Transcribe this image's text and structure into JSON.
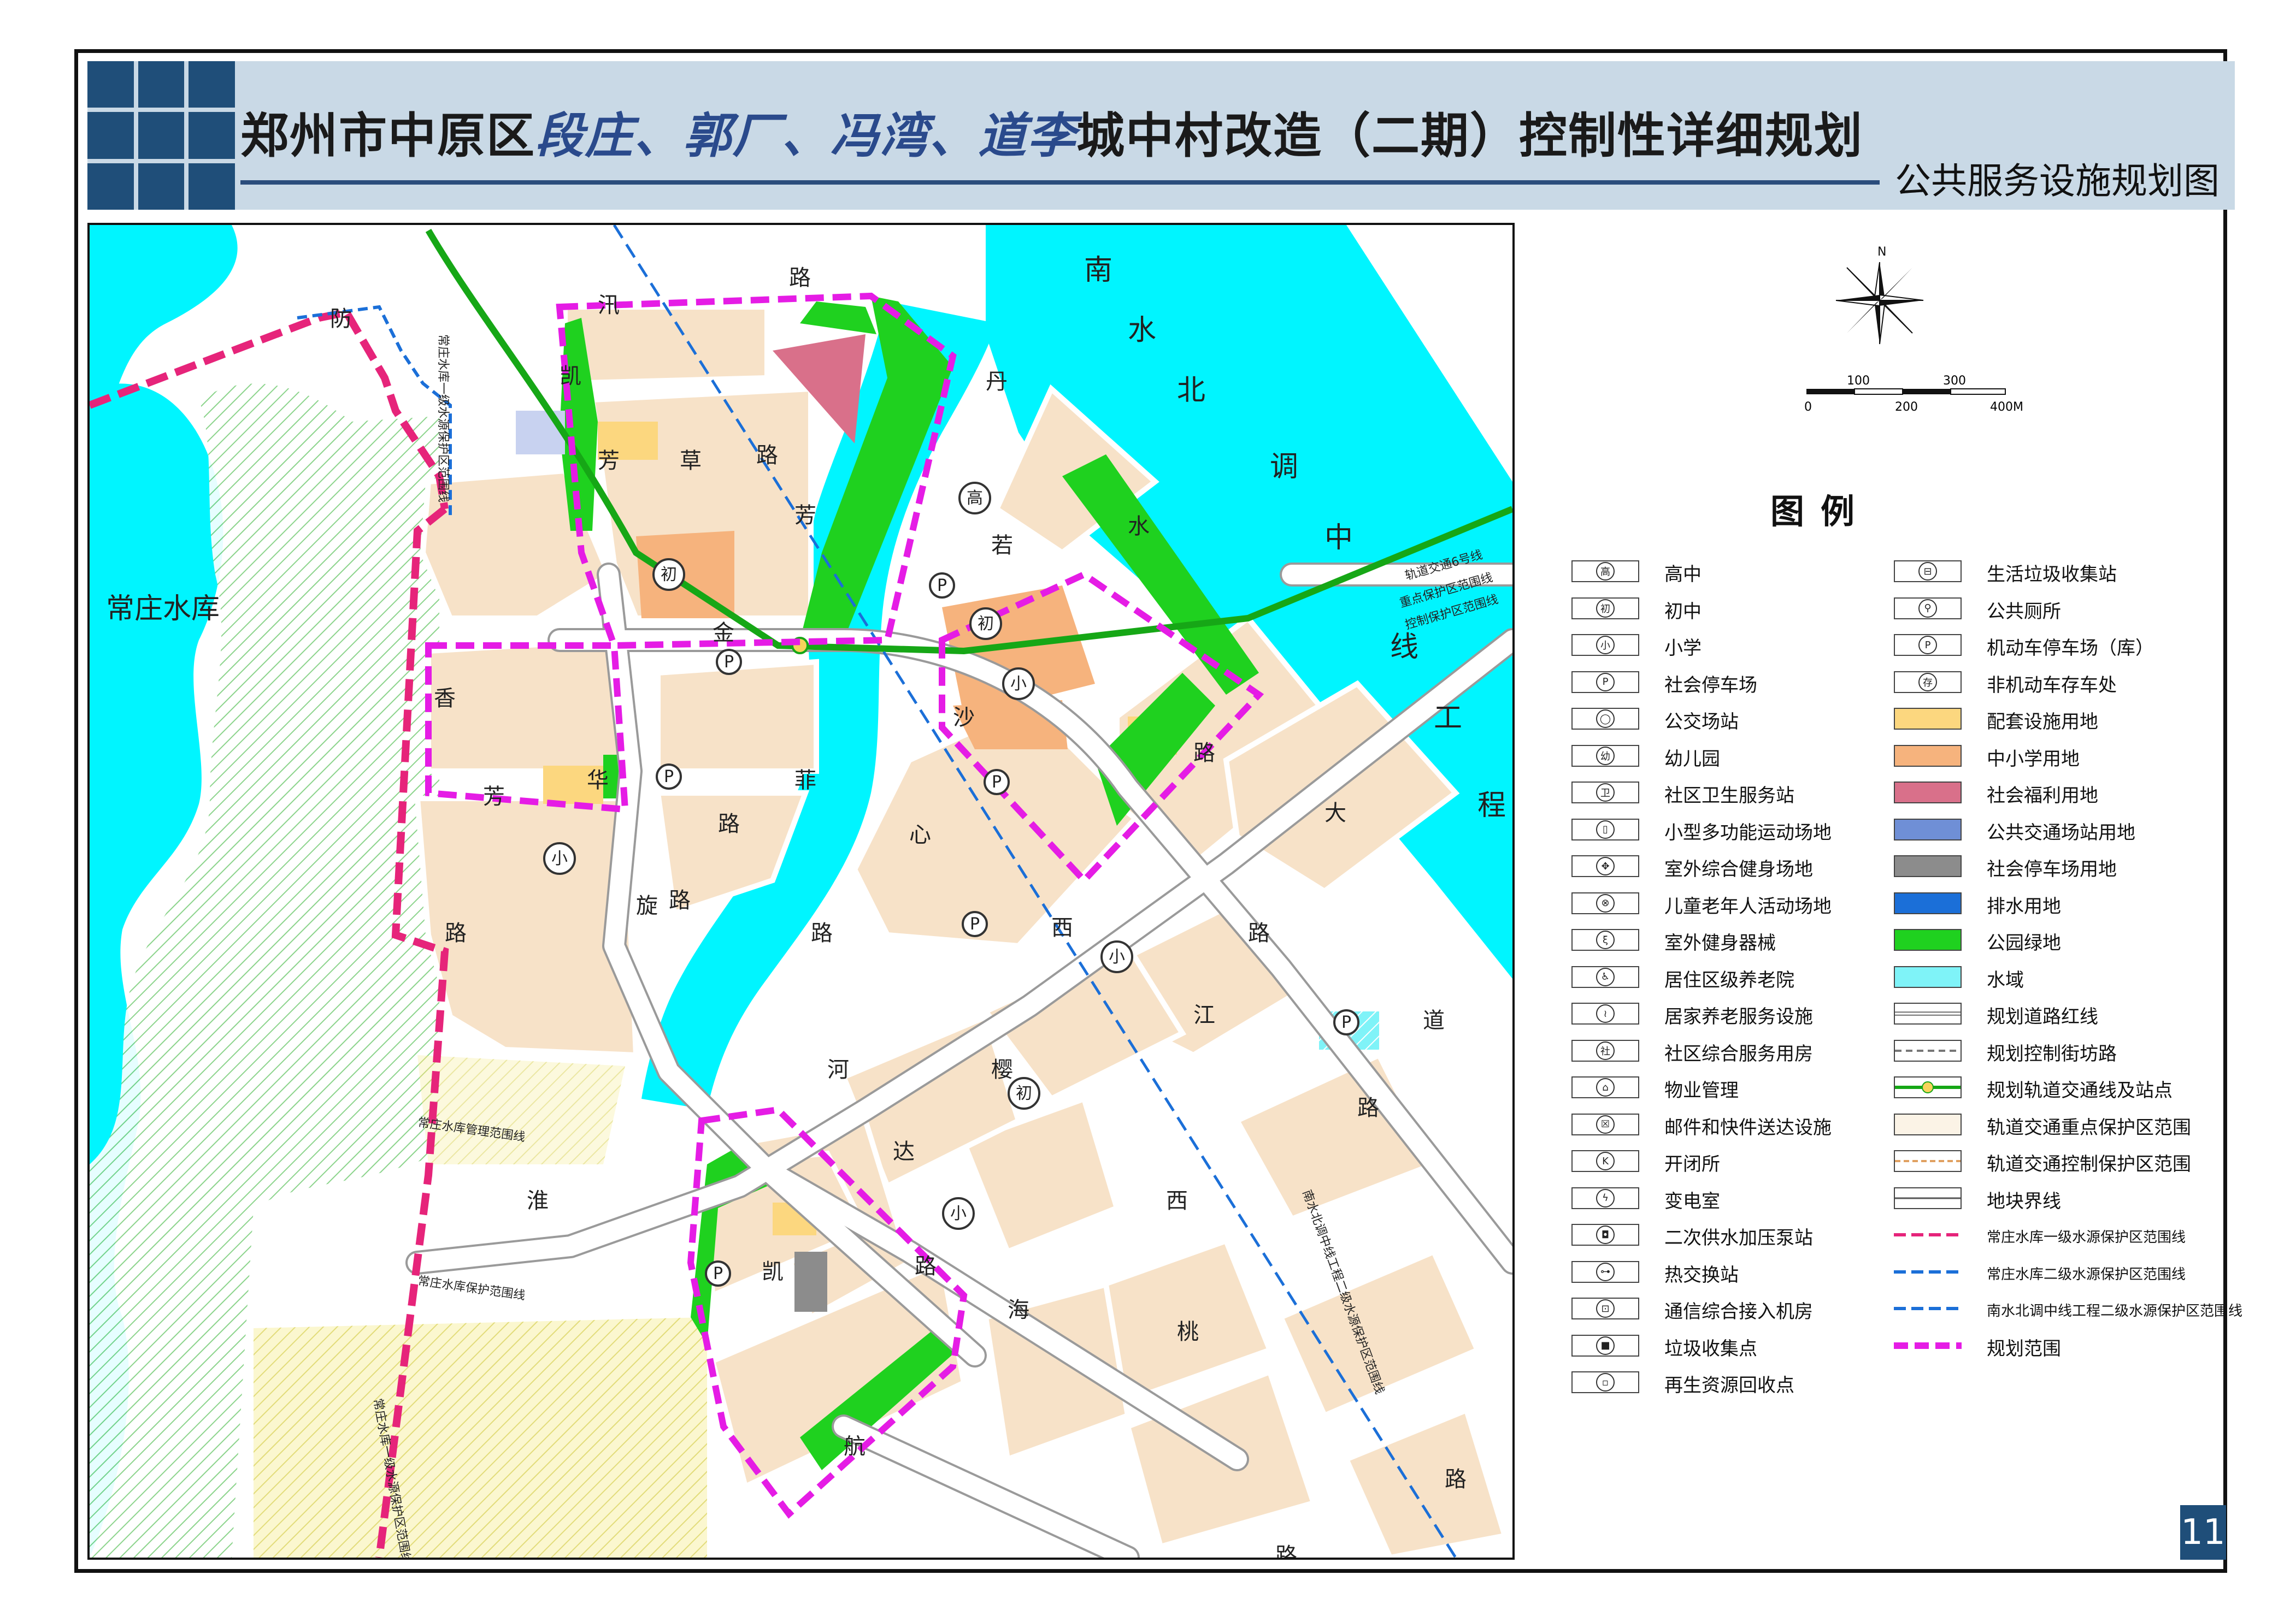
{
  "title": {
    "prefix": "郑州市中原区",
    "villages": "段庄、郭厂、冯湾、道李",
    "suffix": "城中村改造（二期）控制性详细规划"
  },
  "subtitle": "公共服务设施规划图",
  "page_number": "11",
  "scale_bar": {
    "ticks": [
      "0",
      "100",
      "200",
      "300",
      "400M"
    ]
  },
  "north": "N",
  "colors": {
    "water": "#00f5ff",
    "park_green": "#1fd11f",
    "residential": "#f7e2c8",
    "school": "#f6b37d",
    "welfare": "#d9708a",
    "supporting": "#fcd77f",
    "planning_boundary": "#e51ce5",
    "reservoir_boundary": "#e6247a",
    "water_protect_line": "#1b6fd8",
    "rail_line": "#16a716"
  },
  "map": {
    "place_labels": {
      "reservoir": "常庄水库",
      "south_north_canal": [
        "南",
        "水",
        "北",
        "调",
        "中",
        "线",
        "工",
        "程"
      ]
    },
    "road_labels": [
      {
        "text": "防",
        "kind": "road"
      },
      {
        "text": "汛",
        "kind": "road"
      },
      {
        "text": "路",
        "kind": "road"
      },
      {
        "text": "凯",
        "kind": "road"
      },
      {
        "text": "芳",
        "kind": "road"
      },
      {
        "text": "草",
        "kind": "road"
      },
      {
        "text": "路",
        "kind": "road"
      },
      {
        "text": "芳",
        "kind": "road"
      },
      {
        "text": "丹",
        "kind": "road"
      },
      {
        "text": "水",
        "kind": "road"
      },
      {
        "text": "若",
        "kind": "road"
      },
      {
        "text": "金",
        "kind": "road"
      },
      {
        "text": "沙",
        "kind": "road"
      },
      {
        "text": "香",
        "kind": "road"
      },
      {
        "text": "芳",
        "kind": "road"
      },
      {
        "text": "华",
        "kind": "road"
      },
      {
        "text": "菲",
        "kind": "road"
      },
      {
        "text": "路",
        "kind": "road"
      },
      {
        "text": "旋",
        "kind": "road"
      },
      {
        "text": "路",
        "kind": "road"
      },
      {
        "text": "路",
        "kind": "road"
      },
      {
        "text": "心",
        "kind": "road"
      },
      {
        "text": "路",
        "kind": "road"
      },
      {
        "text": "路",
        "kind": "road"
      },
      {
        "text": "大",
        "kind": "road"
      },
      {
        "text": "西",
        "kind": "road"
      },
      {
        "text": "路",
        "kind": "road"
      },
      {
        "text": "江",
        "kind": "road"
      },
      {
        "text": "道",
        "kind": "road"
      },
      {
        "text": "河",
        "kind": "road"
      },
      {
        "text": "樱",
        "kind": "road"
      },
      {
        "text": "路",
        "kind": "road"
      },
      {
        "text": "达",
        "kind": "road"
      },
      {
        "text": "淮",
        "kind": "road"
      },
      {
        "text": "西",
        "kind": "road"
      },
      {
        "text": "凯",
        "kind": "road"
      },
      {
        "text": "路",
        "kind": "road"
      },
      {
        "text": "海",
        "kind": "road"
      },
      {
        "text": "桃",
        "kind": "road"
      },
      {
        "text": "航",
        "kind": "road"
      },
      {
        "text": "路",
        "kind": "road"
      },
      {
        "text": "路",
        "kind": "road"
      }
    ],
    "line_labels": {
      "rail6": "轨道交通6号线",
      "rail_key": "重点保护区范围线",
      "rail_ctrl": "控制保护区范围线",
      "res1": "常庄水库一级水源保护区范围线",
      "res_mgmt": "常庄水库管理范围线",
      "res_protect": "常庄水库保护范围线",
      "res1_south": "常庄水库一级水源保护区范围线",
      "canal2": "南水北调中线工程二级水源保护区范围线"
    },
    "facility_badges": {
      "high": "高",
      "middle": "初",
      "primary": "小",
      "parking": "P"
    }
  },
  "legend": {
    "title": "图例",
    "left": [
      {
        "symbol": "高",
        "label": "高中"
      },
      {
        "symbol": "初",
        "label": "初中"
      },
      {
        "symbol": "小",
        "label": "小学"
      },
      {
        "symbol": "P",
        "label": "社会停车场"
      },
      {
        "symbol": "◯",
        "label": "公交场站"
      },
      {
        "symbol": "幼",
        "label": "幼儿园"
      },
      {
        "symbol": "卫",
        "label": "社区卫生服务站"
      },
      {
        "symbol": "▯",
        "label": "小型多功能运动场地"
      },
      {
        "symbol": "✥",
        "label": "室外综合健身场地"
      },
      {
        "symbol": "⊗",
        "label": "儿童老年人活动场地"
      },
      {
        "symbol": "ξ",
        "label": "室外健身器械"
      },
      {
        "symbol": "♿",
        "label": "居住区级养老院"
      },
      {
        "symbol": "≀",
        "label": "居家养老服务设施"
      },
      {
        "symbol": "社",
        "label": "社区综合服务用房"
      },
      {
        "symbol": "⌂",
        "label": "物业管理"
      },
      {
        "symbol": "☒",
        "label": "邮件和快件送达设施"
      },
      {
        "symbol": "K",
        "label": "开闭所"
      },
      {
        "symbol": "ϟ",
        "label": "变电室"
      },
      {
        "symbol": "◘",
        "label": "二次供水加压泵站"
      },
      {
        "symbol": "⊶",
        "label": "热交换站"
      },
      {
        "symbol": "⊡",
        "label": "通信综合接入机房"
      },
      {
        "symbol": "■",
        "label": "垃圾收集点"
      },
      {
        "symbol": "▫",
        "label": "再生资源回收点"
      }
    ],
    "right": [
      {
        "symbol": "⊟",
        "label": "生活垃圾收集站",
        "style": "icon"
      },
      {
        "symbol": "⚲",
        "label": "公共厕所",
        "style": "icon"
      },
      {
        "symbol": "P",
        "label": "机动车停车场（库）",
        "style": "icon"
      },
      {
        "symbol": "存",
        "label": "非机动车存车处",
        "style": "icon"
      },
      {
        "symbol": "",
        "label": "配套设施用地",
        "style": "fill",
        "color": "#fcd77f"
      },
      {
        "symbol": "",
        "label": "中小学用地",
        "style": "fill",
        "color": "#f6b37d"
      },
      {
        "symbol": "",
        "label": "社会福利用地",
        "style": "fill",
        "color": "#d9708a"
      },
      {
        "symbol": "",
        "label": "公共交通场站用地",
        "style": "fill",
        "color": "#6f8fd6"
      },
      {
        "symbol": "",
        "label": "社会停车场用地",
        "style": "fill",
        "color": "#8c8c8c"
      },
      {
        "symbol": "",
        "label": "排水用地",
        "style": "fill",
        "color": "#1b6fd8"
      },
      {
        "symbol": "",
        "label": "公园绿地",
        "style": "fill",
        "color": "#1fd11f"
      },
      {
        "symbol": "",
        "label": "水域",
        "style": "fill",
        "color": "#7ff3f8"
      },
      {
        "symbol": "",
        "label": "规划道路红线",
        "style": "road"
      },
      {
        "symbol": "",
        "label": "规划控制街坊路",
        "style": "dash"
      },
      {
        "symbol": "",
        "label": "规划轨道交通线及站点",
        "style": "rail"
      },
      {
        "symbol": "",
        "label": "轨道交通重点保护区范围",
        "style": "fill",
        "color": "#fbf3e6"
      },
      {
        "symbol": "",
        "label": "轨道交通控制保护区范围",
        "style": "orange-dash"
      },
      {
        "symbol": "",
        "label": "地块界线",
        "style": "plain"
      },
      {
        "symbol": "",
        "label": "常庄水库一级水源保护区范围线",
        "style": "pinkdash",
        "small": true
      },
      {
        "symbol": "",
        "label": "常庄水库二级水源保护区范围线",
        "style": "bluedash",
        "small": true
      },
      {
        "symbol": "",
        "label": "南水北调中线工程二级水源保护区范围线",
        "style": "bluedash2",
        "small": true
      },
      {
        "symbol": "",
        "label": "规划范围",
        "style": "magenta"
      }
    ]
  }
}
